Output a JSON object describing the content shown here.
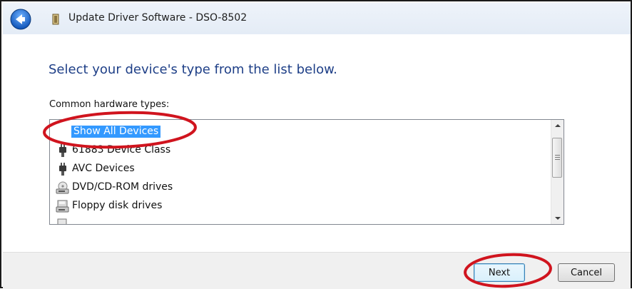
{
  "window": {
    "title": "Update Driver Software - DSO-8502"
  },
  "main": {
    "heading": "Select your device's type from the list below.",
    "list_label": "Common hardware types:",
    "items": [
      {
        "label": "Show All Devices",
        "icon": "none",
        "selected": true
      },
      {
        "label": "61883 Device Class",
        "icon": "device-plug-icon",
        "selected": false
      },
      {
        "label": "AVC Devices",
        "icon": "device-plug-icon",
        "selected": false
      },
      {
        "label": "DVD/CD-ROM drives",
        "icon": "dvd-drive-icon",
        "selected": false
      },
      {
        "label": "Floppy disk drives",
        "icon": "floppy-drive-icon",
        "selected": false
      }
    ]
  },
  "footer": {
    "next_label": "Next",
    "cancel_label": "Cancel"
  },
  "colors": {
    "heading": "#1e3f87",
    "selection": "#3399ff",
    "annotation": "#d0141e"
  }
}
